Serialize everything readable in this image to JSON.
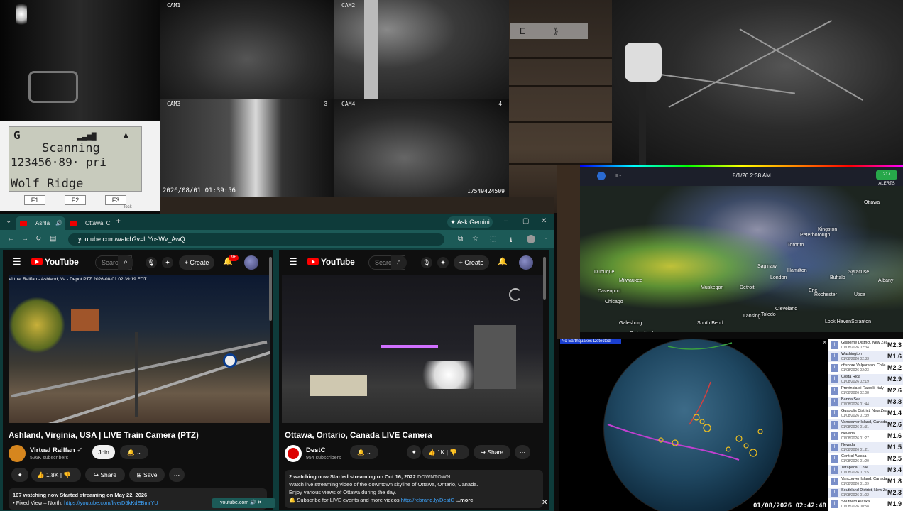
{
  "cameras": {
    "cam1": "CAM1",
    "cam2": "CAM2",
    "cam3": "CAM3",
    "cam4": "CAM4",
    "cam3_num": "3",
    "cam4_num": "4",
    "timestamp": "2026/08/01 01:39:56",
    "serial": "17549424509"
  },
  "scanner": {
    "line1": "G",
    "line2": "Scanning",
    "line3": "123456·89·  pri",
    "line4": "Wolf Ridge",
    "keys": [
      "F1",
      "F2",
      "F3"
    ],
    "lock_label": "lock"
  },
  "gps_badge": "E",
  "browser": {
    "tabs": [
      {
        "label": "Ashla"
      },
      {
        "label": "Ottawa, C"
      }
    ],
    "ask_gemini": "Ask Gemini",
    "url": "youtube.com/watch?v=lLYosWv_AwQ",
    "download_label": "youtube.com"
  },
  "left_pane": {
    "search_placeholder": "Searc",
    "create": "Create",
    "notif_count": "9+",
    "overlay": "Virtual Railfan - Ashland, Va - Depot PTZ  2026-08-01 02:39:19 EDT",
    "title": "Ashland, Virginia, USA | LIVE Train Camera (PTZ)",
    "channel": "Virtual Railfan",
    "subs": "526K subscribers",
    "join": "Join",
    "likes": "1.8K",
    "share": "Share",
    "save": "Save",
    "desc_line1": "107 watching now  Started streaming on May 22, 2026",
    "desc_line2_pre": "• Fixed View – North: ",
    "desc_line2_link": "https://youtube.com/live/D5kKdEBmrYU"
  },
  "right_pane": {
    "search_placeholder": "Searc",
    "create": "Create",
    "title": "Ottawa, Ontario, Canada LIVE Camera",
    "channel": "DestC",
    "subs": "954 subscribers",
    "likes": "1K",
    "share": "Share",
    "desc_line1_pre": "2 watching now  Started streaming on Oct 16, 2022  ",
    "desc_line1_tag": "DOWNTOWN",
    "desc_line2": "Watch live streaming video of the downtown skyline of Ottawa, Ontario, Canada.",
    "desc_line3": "Enjoy various views of Ottawa during the day.",
    "desc_line4_pre": "🔔 Subscribe for LIVE events and more videos ",
    "desc_line4_link": "http://rebrand.ly/DestC",
    "more": "...more"
  },
  "radar": {
    "time": "8/1/26 2:38 AM",
    "alerts": "217 ALERTS",
    "cities": [
      "Ottawa",
      "Kingston",
      "Peterborough",
      "Toronto",
      "Hamilton",
      "London",
      "Buffalo",
      "Syracuse",
      "Albany",
      "Detroit",
      "Cleveland",
      "Erie",
      "Lansing",
      "Chicago",
      "South Bend",
      "Toledo",
      "Scranton",
      "Lock Haven",
      "Springfield",
      "Saginaw",
      "Milwaukee",
      "Bloomington",
      "Columbus",
      "Muskegon",
      "Utica",
      "Rochester",
      "Dubuque",
      "Davenport",
      "Galesburg"
    ]
  },
  "quake": {
    "banner": "No Earthquakes Detected",
    "time": "01/08/2026 02:42:48",
    "list": [
      {
        "name": "Gisborne District, New Zeal...",
        "time": "01/08/2026 02:34",
        "mag": "M2.3"
      },
      {
        "name": "Washington",
        "time": "01/08/2026 02:33",
        "mag": "M1.6"
      },
      {
        "name": "offshore Valparaiso, Chile",
        "time": "01/08/2026 02:23",
        "mag": "M2.2"
      },
      {
        "name": "Costa Rica",
        "time": "01/08/2026 02:19",
        "mag": "M2.9"
      },
      {
        "name": "Provincia di Rapolli, Italy",
        "time": "01/08/2026 02:08",
        "mag": "M2.6"
      },
      {
        "name": "Banda Sea",
        "time": "01/08/2026 01:44",
        "mag": "M3.8"
      },
      {
        "name": "Guapolis District, New Zeal...",
        "time": "01/08/2026 01:39",
        "mag": "M1.4"
      },
      {
        "name": "Vancouver Island, Canada r...",
        "time": "01/08/2026 01:31",
        "mag": "M2.6"
      },
      {
        "name": "Nevada",
        "time": "01/08/2026 01:27",
        "mag": "M1.6"
      },
      {
        "name": "Nevada",
        "time": "01/08/2026 01:21",
        "mag": "M1.5"
      },
      {
        "name": "Central Alaska",
        "time": "01/08/2026 01:20",
        "mag": "M2.5"
      },
      {
        "name": "Tarapaca, Chile",
        "time": "01/08/2026 01:15",
        "mag": "M3.4"
      },
      {
        "name": "Vancouver Island, Canada r...",
        "time": "01/08/2026 01:09",
        "mag": "M1.8"
      },
      {
        "name": "Southland District, New Zeal...",
        "time": "01/08/2026 01:02",
        "mag": "M2.3"
      },
      {
        "name": "Southern Alaska",
        "time": "01/08/2026 00:58",
        "mag": "M1.9"
      }
    ]
  }
}
